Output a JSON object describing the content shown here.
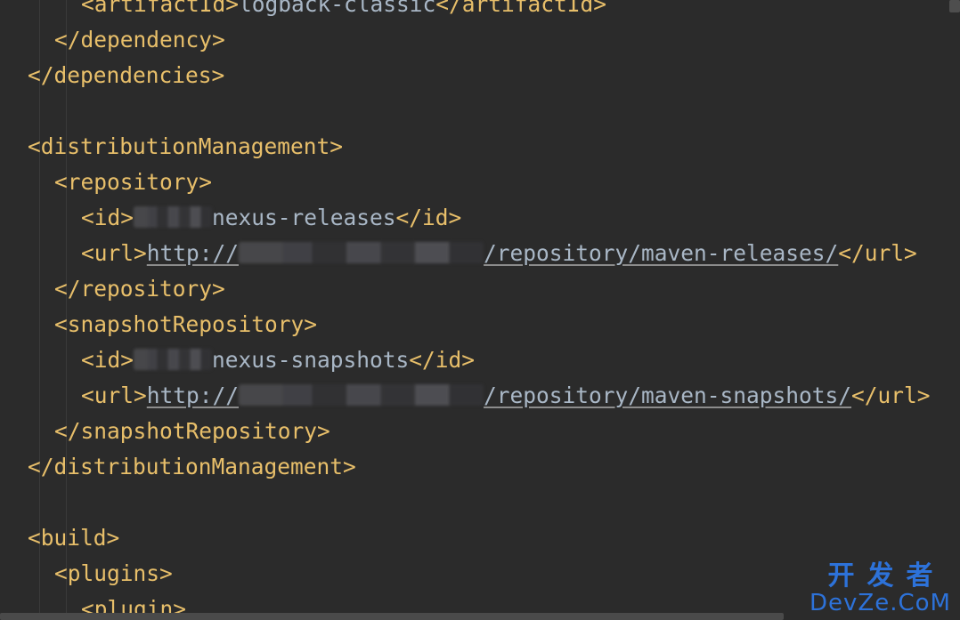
{
  "editor": {
    "lines": [
      {
        "indent": 3,
        "parts": [
          {
            "t": "tag",
            "v": "<artifactId>"
          },
          {
            "t": "txt",
            "v": "logback-classic"
          },
          {
            "t": "tag",
            "v": "</artifactId>"
          }
        ]
      },
      {
        "indent": 2,
        "parts": [
          {
            "t": "tag",
            "v": "</dependency>"
          }
        ]
      },
      {
        "indent": 1,
        "parts": [
          {
            "t": "tag",
            "v": "</dependencies>"
          }
        ]
      },
      {
        "indent": 0,
        "parts": []
      },
      {
        "indent": 1,
        "parts": [
          {
            "t": "tag",
            "v": "<distributionManagement>"
          }
        ]
      },
      {
        "indent": 2,
        "parts": [
          {
            "t": "tag",
            "v": "<repository>"
          }
        ]
      },
      {
        "indent": 3,
        "parts": [
          {
            "t": "tag",
            "v": "<id>"
          },
          {
            "t": "blur",
            "w": 88
          },
          {
            "t": "txt",
            "v": "nexus-releases"
          },
          {
            "t": "tag",
            "v": "</id>"
          }
        ]
      },
      {
        "indent": 3,
        "parts": [
          {
            "t": "tag",
            "v": "<url>"
          },
          {
            "t": "url",
            "v": "http://"
          },
          {
            "t": "blur",
            "w": 275
          },
          {
            "t": "url",
            "v": "/repository/maven-releases/"
          },
          {
            "t": "tag",
            "v": "</url>"
          }
        ]
      },
      {
        "indent": 2,
        "parts": [
          {
            "t": "tag",
            "v": "</repository>"
          }
        ]
      },
      {
        "indent": 2,
        "parts": [
          {
            "t": "tag",
            "v": "<snapshotRepository>"
          }
        ]
      },
      {
        "indent": 3,
        "parts": [
          {
            "t": "tag",
            "v": "<id>"
          },
          {
            "t": "blur",
            "w": 88
          },
          {
            "t": "txt",
            "v": "nexus-snapshots"
          },
          {
            "t": "tag",
            "v": "</id>"
          }
        ]
      },
      {
        "indent": 3,
        "parts": [
          {
            "t": "tag",
            "v": "<url>"
          },
          {
            "t": "url",
            "v": "http://"
          },
          {
            "t": "blur",
            "w": 275
          },
          {
            "t": "url",
            "v": "/repository/maven-snapshots/"
          },
          {
            "t": "tag",
            "v": "</url>"
          }
        ]
      },
      {
        "indent": 2,
        "parts": [
          {
            "t": "tag",
            "v": "</snapshotRepository>"
          }
        ]
      },
      {
        "indent": 1,
        "parts": [
          {
            "t": "tag",
            "v": "</distributionManagement>"
          }
        ]
      },
      {
        "indent": 0,
        "parts": []
      },
      {
        "indent": 1,
        "parts": [
          {
            "t": "tag",
            "v": "<build>"
          }
        ]
      },
      {
        "indent": 2,
        "parts": [
          {
            "t": "tag",
            "v": "<plugins>"
          }
        ]
      },
      {
        "indent": 3,
        "parts": [
          {
            "t": "tag",
            "v": "<plugin>"
          }
        ]
      }
    ]
  },
  "watermark": {
    "cn": "开发者",
    "en": "DevZe.CoM"
  },
  "colors": {
    "background": "#2b2b2b",
    "tag": "#e8bf6a",
    "text": "#a9b7c6",
    "watermark": "#2d72d9"
  }
}
